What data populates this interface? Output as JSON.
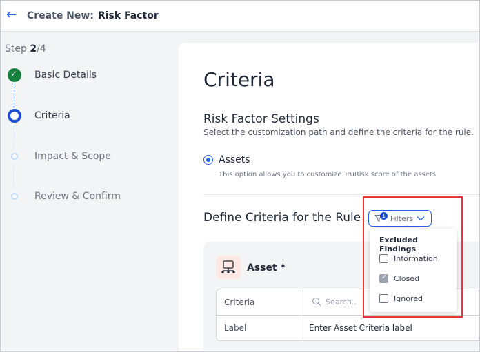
{
  "header": {
    "back_icon": "arrow-left-icon",
    "title_label": "Create New:",
    "title_name": "Risk Factor"
  },
  "stepper": {
    "prefix": "Step ",
    "current": "2",
    "total": "/4",
    "steps": [
      {
        "label": "Basic Details",
        "state": "done"
      },
      {
        "label": "Criteria",
        "state": "current"
      },
      {
        "label": "Impact & Scope",
        "state": "pending"
      },
      {
        "label": "Review & Confirm",
        "state": "pending"
      }
    ]
  },
  "main": {
    "heading": "Criteria",
    "settings_title": "Risk Factor Settings",
    "settings_desc": "Select the customization path and define the criteria for the rule.",
    "option_label": "Assets",
    "option_desc": "This option allows you to customize TruRisk score of the assets",
    "define_title": "Define Criteria for the Rule",
    "filters_label": "Filters",
    "filters_badge": "1",
    "asset_title": "Asset *",
    "table": {
      "row1_label": "Criteria",
      "search_placeholder": "Search..",
      "row2_label": "Label",
      "row2_value": "Enter Asset Criteria label"
    }
  },
  "filters_dropdown": {
    "title": "Excluded Findings",
    "items": [
      {
        "label": "Information",
        "checked": false
      },
      {
        "label": "Closed",
        "checked": true
      },
      {
        "label": "Ignored",
        "checked": false
      }
    ]
  },
  "colors": {
    "accent": "#2563eb",
    "done": "#15803d",
    "highlight": "#e53935"
  }
}
